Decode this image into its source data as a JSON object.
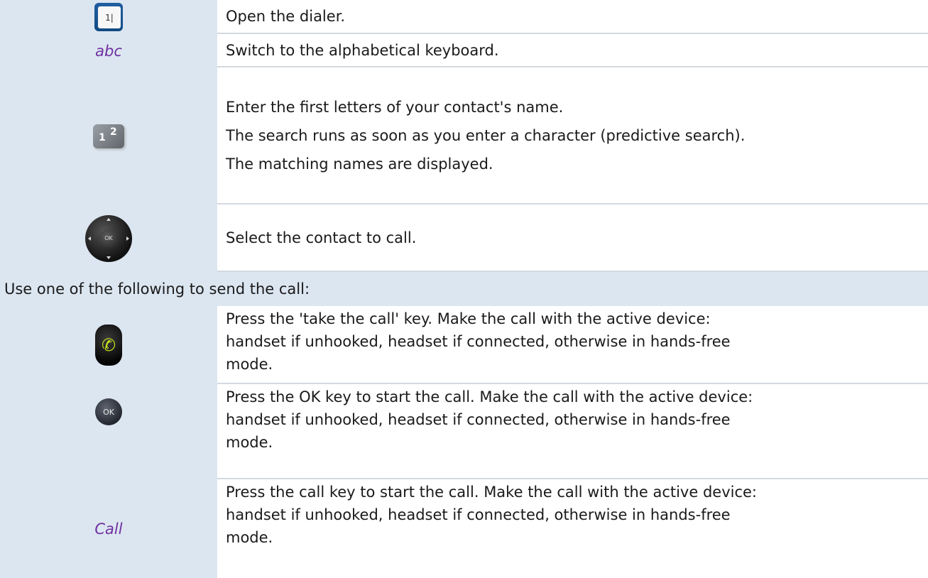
{
  "rows": [
    {
      "icon": "dialer-icon",
      "icon_text": "1|",
      "text": [
        "Open the dialer."
      ]
    },
    {
      "softkey": "abc",
      "text": [
        "Switch to the alphabetical keyboard."
      ]
    },
    {
      "icon": "keypad-icon",
      "icon_keys": [
        "1",
        "2"
      ],
      "text": [
        "Enter the first letters of your contact's name.",
        "The search runs as soon as you enter a character (predictive search).",
        "The matching names are displayed."
      ]
    },
    {
      "icon": "navigator-icon",
      "icon_text": "OK",
      "text": [
        "Select the contact to call."
      ]
    }
  ],
  "section_heading": "Use one of the following to send the call:",
  "send_rows": [
    {
      "icon": "take-call-icon",
      "icon_glyph": "✆",
      "text": [
        "Press the 'take the call' key. Make the call with the active device:",
        "handset if unhooked, headset if connected, otherwise in hands-free",
        "mode."
      ]
    },
    {
      "icon": "ok-key-icon",
      "icon_text": "OK",
      "text": [
        "Press the OK key to start the call. Make the call with the active device:",
        "handset if unhooked, headset if connected, otherwise in hands-free",
        "mode."
      ]
    },
    {
      "softkey": "Call",
      "text": [
        "Press the call key to start the call. Make the call with the active device:",
        "handset if unhooked, headset if connected, otherwise in hands-free",
        "mode."
      ]
    }
  ],
  "colors": {
    "icon_cell_bg": "#dce6f1",
    "softkey_text": "#7030a0",
    "divider": "#d4d9df"
  }
}
